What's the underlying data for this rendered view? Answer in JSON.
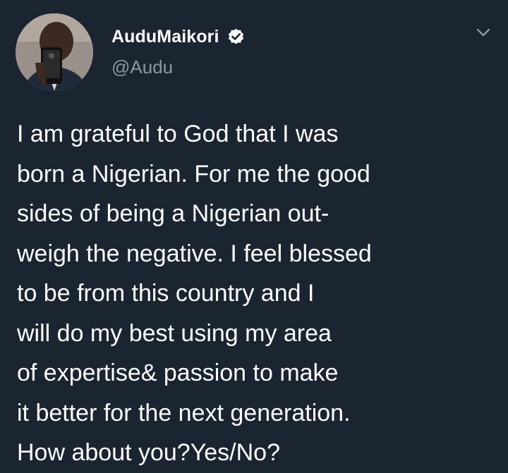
{
  "tweet": {
    "author": {
      "display_name": "AuduMaikori",
      "handle": "@Audu",
      "verified": true,
      "avatar": "profile-photo"
    },
    "text": "I am grateful to God that I was\nborn a Nigerian. For me the good\nsides of being a Nigerian out-\nweigh the negative. I feel blessed\nto be from this country and I\nwill do my best using my area\nof expertise& passion to make\nit better for the next generation.\nHow about you?Yes/No?",
    "menu_icon": "chevron-down-icon"
  },
  "colors": {
    "background": "#1b2431",
    "text": "#ffffff",
    "secondary_text": "#8899a6",
    "verified_badge": "#ffffff"
  }
}
